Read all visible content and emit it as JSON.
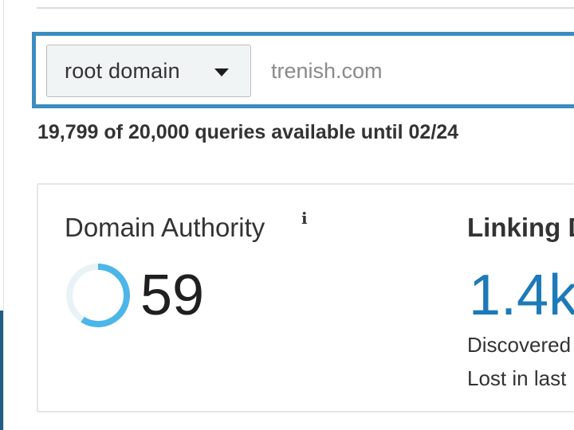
{
  "search": {
    "scope_label": "root domain",
    "query_placeholder": "trenish.com",
    "query_value": ""
  },
  "quota": {
    "text": "19,799 of 20,000 queries available until 02/24"
  },
  "metrics": {
    "domain_authority": {
      "title": "Domain Authority",
      "info_glyph": "i",
      "value": "59",
      "score": 59,
      "max": 100,
      "ring_color": "#4db6e8",
      "ring_track_color": "#e9f2f5"
    },
    "linking_domains": {
      "title": "Linking D",
      "value": "1.4k",
      "discovered_label": "Discovered",
      "lost_label": "Lost in last"
    }
  },
  "colors": {
    "accent_border": "#3a8dbe",
    "link_value": "#1d7ab8"
  }
}
